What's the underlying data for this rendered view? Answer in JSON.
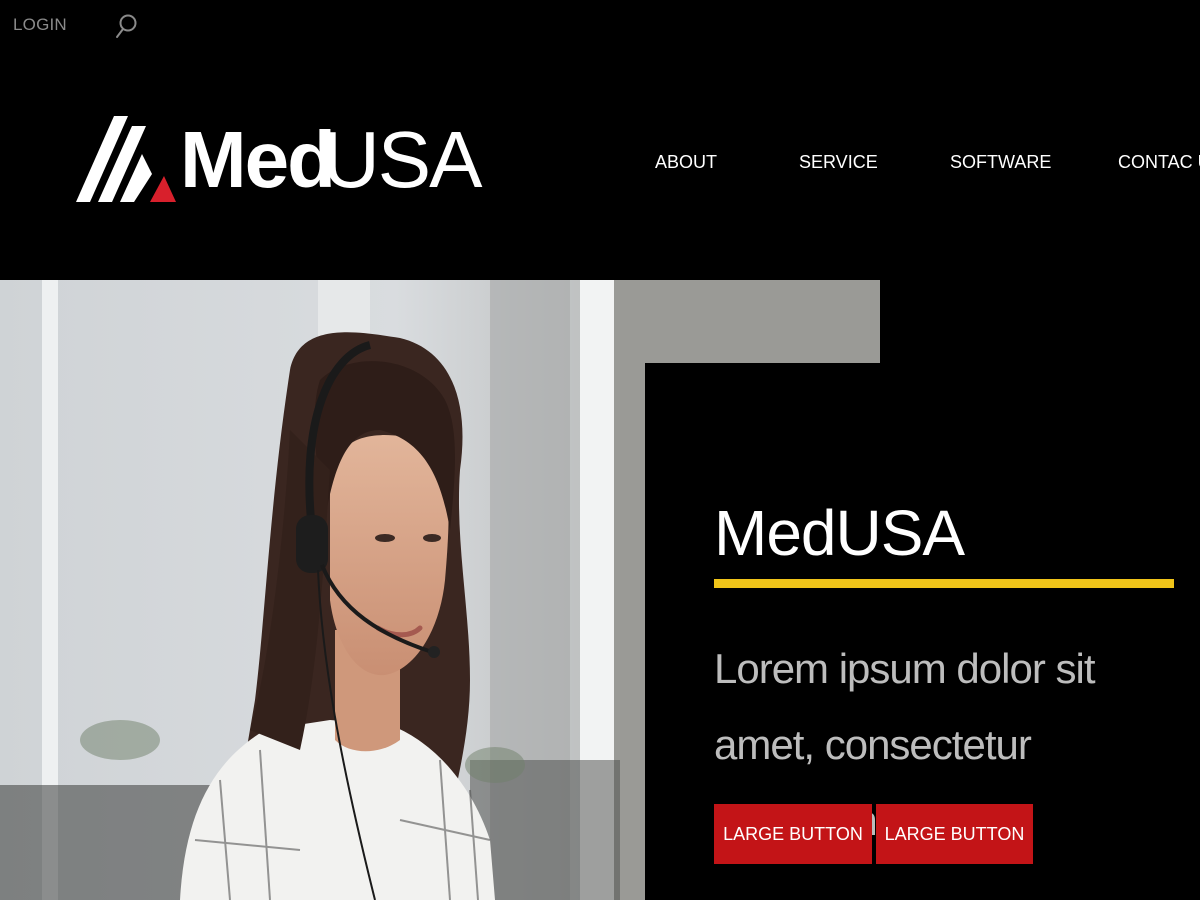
{
  "topbar": {
    "login_label": "LOGIN",
    "search_icon": "search-icon"
  },
  "logo": {
    "mark_icon": "mountain-logo-icon",
    "text_bold": "Med",
    "text_light": "USA",
    "accent_color": "#d8202c"
  },
  "nav": {
    "about": "ABOUT",
    "service": "SERVICE",
    "software": "SOFTWARE",
    "contact": "CONTAC US"
  },
  "hero": {
    "image": "woman-with-headset-photo",
    "title": "MedUSA",
    "text": "Lorem ipsum dolor sit amet, consectetur adipisicing elit.",
    "rule_color": "#f0c419",
    "buttons": [
      "LARGE BUTTON",
      "LARGE BUTTON"
    ],
    "button_color": "#c31417"
  }
}
